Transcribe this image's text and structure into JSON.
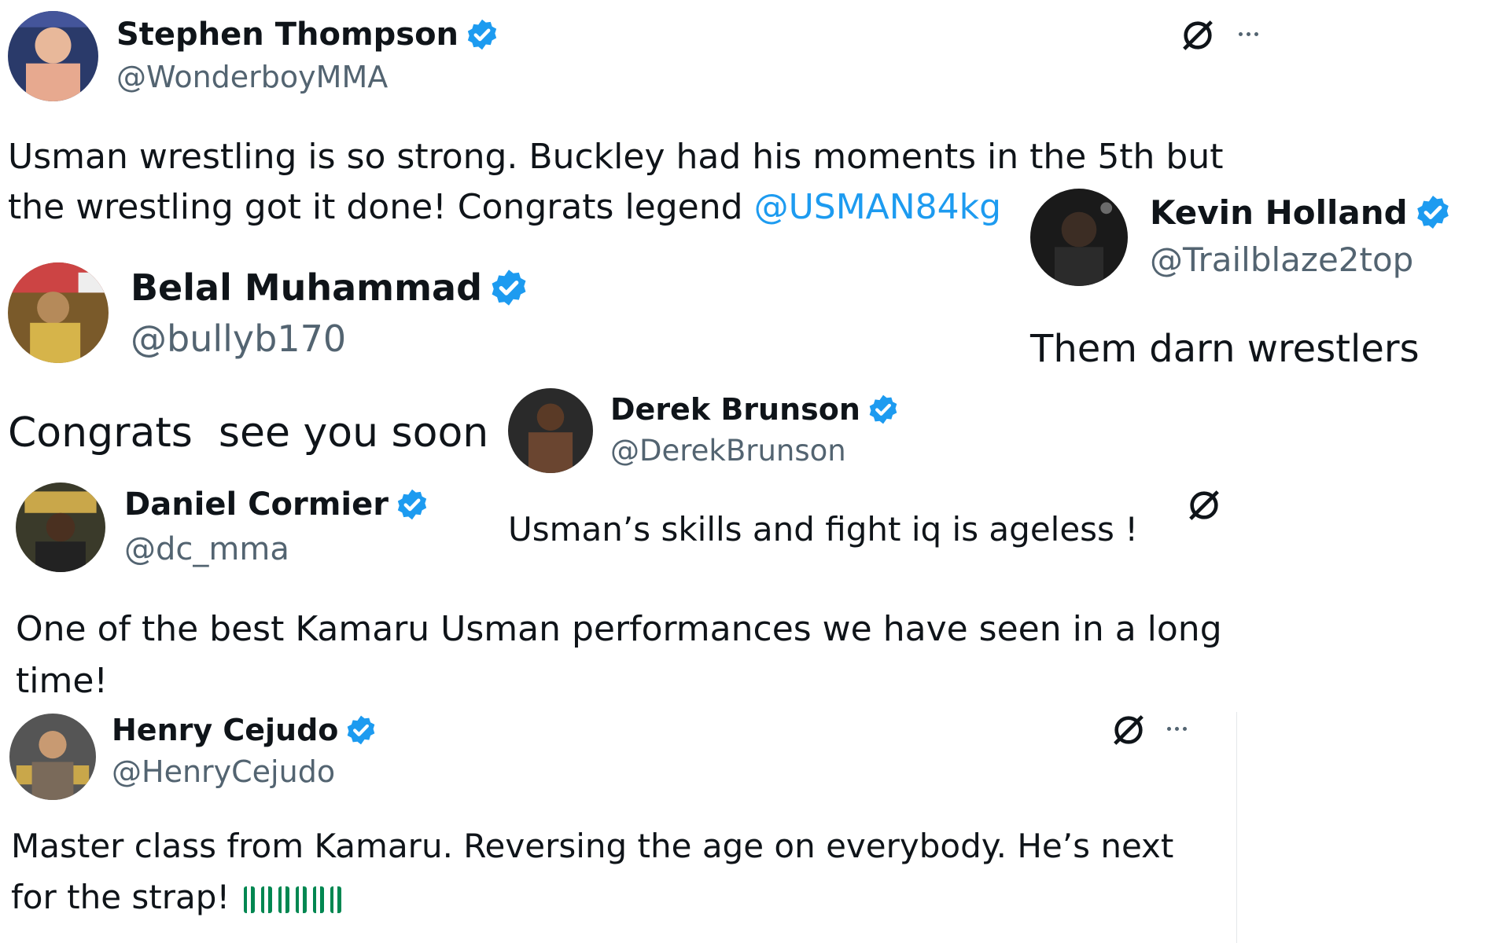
{
  "tweets": [
    {
      "name": "Stephen Thompson",
      "handle": "@WonderboyMMA",
      "text": "Usman wrestling is so strong. Buckley had his moments in the 5th but the wrestling got it done! Congrats legend ",
      "mention": "@USMAN84kg"
    },
    {
      "name": "Kevin Holland",
      "handle": "@Trailblaze2top",
      "text": "Them darn wrestlers"
    },
    {
      "name": "Belal Muhammad",
      "handle": "@bullyb170",
      "text": "Congrats  see you soon"
    },
    {
      "name": "Derek Brunson",
      "handle": "@DerekBrunson",
      "text": "Usman’s skills and fight iq is ageless !"
    },
    {
      "name": "Daniel Cormier",
      "handle": "@dc_mma",
      "text": "One of the best Kamaru Usman performances we have seen in a long time!"
    },
    {
      "name": "Henry Cejudo",
      "handle": "@HenryCejudo",
      "text": "Master class from Kamaru. Reversing the age on everybody. He’s next for the strap! "
    }
  ],
  "colors": {
    "verified_badge": "#1d9bf0",
    "mention": "#1d9bf0",
    "handle": "#536471",
    "flag_green": "#008751",
    "flag_white": "#ffffff"
  },
  "icons": {
    "verified": "verified-badge-icon",
    "grok": "grok-icon",
    "more": "more-options-icon",
    "flag": "nigeria-flag-emoji"
  }
}
